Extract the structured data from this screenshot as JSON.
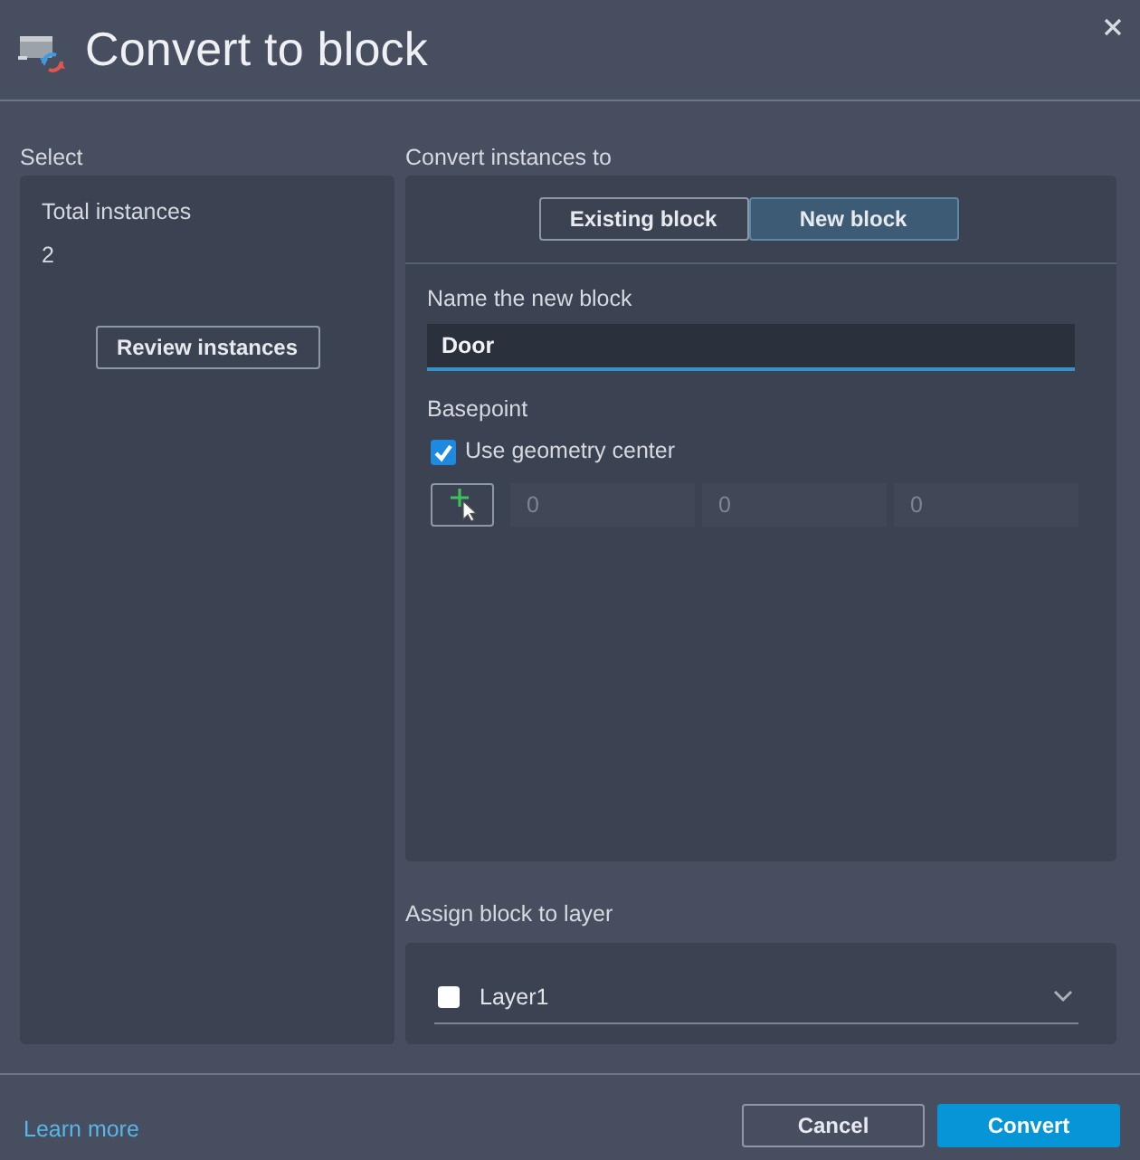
{
  "window": {
    "title": "Convert to block"
  },
  "select": {
    "heading": "Select",
    "total_label": "Total instances",
    "total_value": "2",
    "review_button": "Review instances"
  },
  "convert": {
    "heading": "Convert instances to",
    "tabs": [
      {
        "label": "Existing block",
        "selected": false
      },
      {
        "label": "New block",
        "selected": true
      }
    ],
    "name_label": "Name the new block",
    "name_field": {
      "value": "Door"
    },
    "basepoint": {
      "label": "Basepoint",
      "use_center": {
        "label": "Use geometry center",
        "checked": true
      },
      "coordinates": [
        {
          "value": "0",
          "disabled": true
        },
        {
          "value": "0",
          "disabled": true
        },
        {
          "value": "0",
          "disabled": true
        }
      ]
    }
  },
  "layer": {
    "heading": "Assign block to layer",
    "dropdown": {
      "value": "Layer1",
      "color": "#ffffff"
    }
  },
  "footer": {
    "link": "Learn more",
    "buttons": [
      {
        "label": "Cancel",
        "kind": "secondary"
      },
      {
        "label": "Convert",
        "kind": "primary"
      }
    ]
  }
}
